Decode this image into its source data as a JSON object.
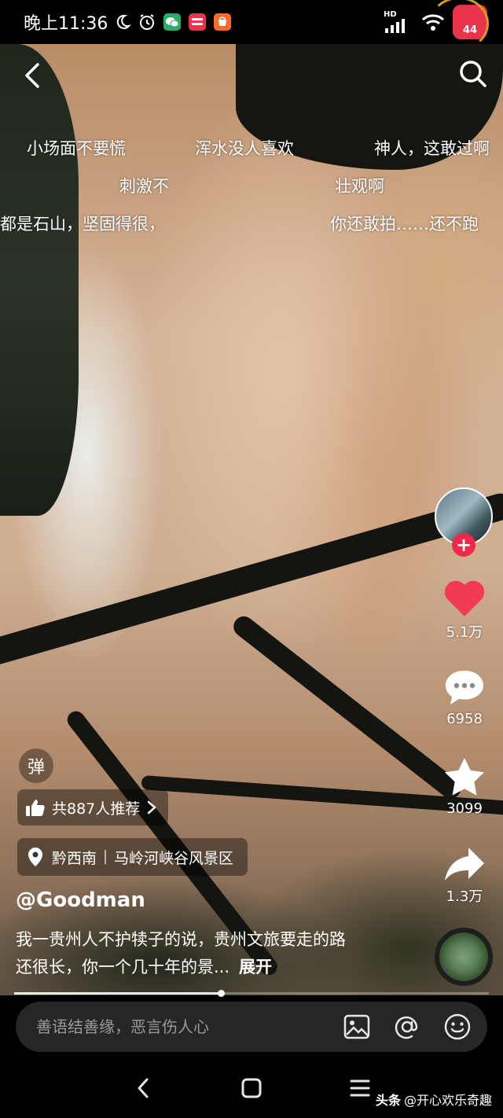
{
  "status_bar": {
    "time": "晚上11:36",
    "network_label": "HD",
    "battery_level": "44"
  },
  "danmaku": [
    "小场面不要慌",
    "浑水没人喜欢",
    "神人，这敢过啊",
    "刺激不",
    "壮观啊",
    "都是石山，坚固得很，",
    "你还敢拍……还不跑"
  ],
  "actions": {
    "likes": "5.1万",
    "comments": "6958",
    "favorites": "3099",
    "shares": "1.3万"
  },
  "overlay": {
    "danmu_toggle": "弹",
    "recommend": "共887人推荐",
    "location_region": "黔西南",
    "location_place": "马岭河峡谷风景区",
    "author": "@Goodman",
    "description": "我一贵州人不护犊子的说，贵州文旅要走的路还很长，你一个几十年的景...",
    "expand": "展开"
  },
  "progress": {
    "fraction": 0.435
  },
  "comment_bar": {
    "placeholder": "善语结善缘，恶言伤人心"
  },
  "watermark": {
    "brand": "头条",
    "handle": "@开心欢乐奇趣"
  },
  "colors": {
    "like_red": "#f23a55",
    "follow_red": "#f0284b",
    "comment_bar_bg": "#262626"
  }
}
